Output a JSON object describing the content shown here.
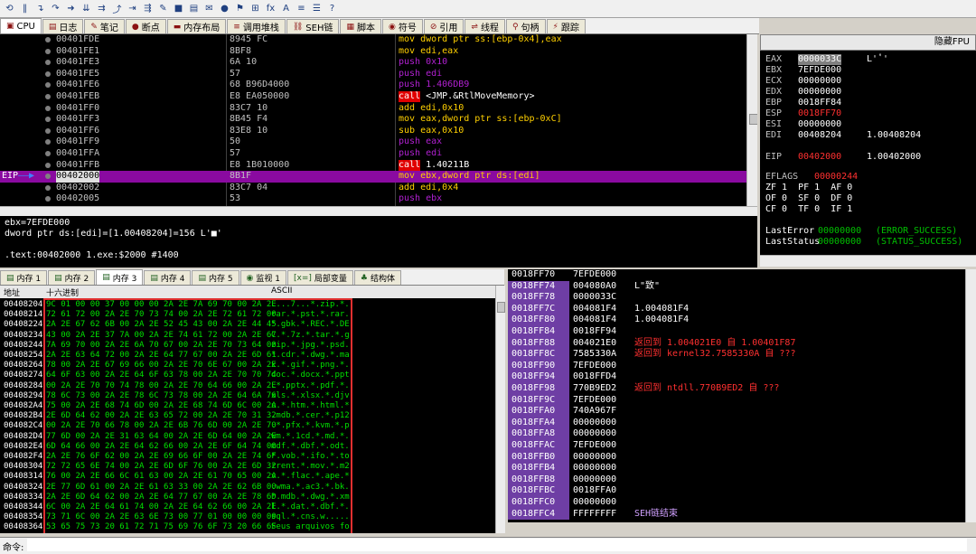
{
  "toolbar": {
    "icons": [
      "restart-icon",
      "pause-icon",
      "step-into-icon",
      "step-over-icon",
      "run-icon",
      "trace-into-icon",
      "trace-over-icon",
      "execute-till-return-icon",
      "run-to-user-icon",
      "animate-icon",
      "patch-icon",
      "lock-icon",
      "memory-map-icon",
      "comment-icon",
      "breakpoint-icon",
      "bookmark-icon",
      "calculator-icon",
      "fx-icon",
      "font-icon",
      "asm-icon",
      "list-icon",
      "help-icon"
    ],
    "glyphs": [
      "⟲",
      "‖",
      "↴",
      "↷",
      "➜",
      "⇊",
      "⇉",
      "⤴",
      "⇥",
      "⇶",
      "✎",
      "■",
      "▤",
      "✉",
      "●",
      "⚑",
      "⊞",
      "fx",
      "A",
      "≡",
      "☰",
      "?"
    ]
  },
  "tabs": [
    {
      "label": "CPU",
      "icon": "cpu-icon",
      "glyph": "▣",
      "active": true
    },
    {
      "label": "日志",
      "icon": "log-icon",
      "glyph": "▤"
    },
    {
      "label": "笔记",
      "icon": "notes-icon",
      "glyph": "✎"
    },
    {
      "label": "断点",
      "icon": "breakpoint-icon",
      "glyph": "●"
    },
    {
      "label": "内存布局",
      "icon": "memory-map-icon",
      "glyph": "▬"
    },
    {
      "label": "调用堆栈",
      "icon": "call-stack-icon",
      "glyph": "≡"
    },
    {
      "label": "SEH链",
      "icon": "seh-icon",
      "glyph": "⛓"
    },
    {
      "label": "脚本",
      "icon": "script-icon",
      "glyph": "▦"
    },
    {
      "label": "符号",
      "icon": "symbol-icon",
      "glyph": "◉"
    },
    {
      "label": "引用",
      "icon": "reference-icon",
      "glyph": "⊘"
    },
    {
      "label": "线程",
      "icon": "thread-icon",
      "glyph": "⇌"
    },
    {
      "label": "句柄",
      "icon": "handle-icon",
      "glyph": "⚲"
    },
    {
      "label": "跟踪",
      "icon": "trace-icon",
      "glyph": "⚡"
    }
  ],
  "fpu_toggle": "隐藏FPU",
  "cpu": {
    "eip_label": "EIP",
    "rows": [
      {
        "addr": "00401FDE",
        "bytes": "8945 FC",
        "asm": "mov dword ptr ss:[ebp-0x4],eax",
        "kind": "normal"
      },
      {
        "addr": "00401FE1",
        "bytes": "8BF8",
        "asm": "mov edi,eax",
        "kind": "normal"
      },
      {
        "addr": "00401FE3",
        "bytes": "6A 10",
        "asm": "push 0x10",
        "kind": "push"
      },
      {
        "addr": "00401FE5",
        "bytes": "57",
        "asm": "push edi",
        "kind": "push"
      },
      {
        "addr": "00401FE6",
        "bytes": "68 B96D4000",
        "asm": "push 1.406DB9",
        "kind": "push"
      },
      {
        "addr": "00401FEB",
        "bytes": "E8 EA050000",
        "asm": "call <JMP.&RtlMoveMemory>",
        "kind": "call"
      },
      {
        "addr": "00401FF0",
        "bytes": "83C7 10",
        "asm": "add edi,0x10",
        "kind": "normal"
      },
      {
        "addr": "00401FF3",
        "bytes": "8B45 F4",
        "asm": "mov eax,dword ptr ss:[ebp-0xC]",
        "kind": "normal"
      },
      {
        "addr": "00401FF6",
        "bytes": "83E8 10",
        "asm": "sub eax,0x10",
        "kind": "normal"
      },
      {
        "addr": "00401FF9",
        "bytes": "50",
        "asm": "push eax",
        "kind": "push"
      },
      {
        "addr": "00401FFA",
        "bytes": "57",
        "asm": "push edi",
        "kind": "push"
      },
      {
        "addr": "00401FFB",
        "bytes": "E8 1B010000",
        "asm": "call 1.40211B",
        "kind": "call"
      },
      {
        "addr": "00402000",
        "bytes": "8B1F",
        "asm": "mov ebx,dword ptr ds:[edi]",
        "kind": "current"
      },
      {
        "addr": "00402002",
        "bytes": "83C7 04",
        "asm": "add edi,0x4",
        "kind": "normal"
      },
      {
        "addr": "00402005",
        "bytes": "53",
        "asm": "push ebx",
        "kind": "push"
      }
    ]
  },
  "info": {
    "line1": "ebx=7EFDE000",
    "line2": "dword ptr ds:[edi]=[1.00408204]=156 L'■'",
    "line3": ".text:00402000 1.exe:$2000 #1400"
  },
  "registers": [
    {
      "name": "EAX",
      "value": "0000033C",
      "comment": "L'ʽ'",
      "highlight": true
    },
    {
      "name": "EBX",
      "value": "7EFDE000",
      "comment": ""
    },
    {
      "name": "ECX",
      "value": "00000000",
      "comment": ""
    },
    {
      "name": "EDX",
      "value": "00000000",
      "comment": ""
    },
    {
      "name": "EBP",
      "value": "0018FF84",
      "comment": ""
    },
    {
      "name": "ESP",
      "value": "0018FF70",
      "comment": "",
      "red": true
    },
    {
      "name": "ESI",
      "value": "00000000",
      "comment": ""
    },
    {
      "name": "EDI",
      "value": "00408204",
      "comment": "1.00408204"
    }
  ],
  "eip": {
    "name": "EIP",
    "value": "00402000",
    "comment": "1.00402000"
  },
  "eflags": {
    "label": "EFLAGS",
    "value": "00000244"
  },
  "flags_line1": "ZF 1  PF 1  AF 0",
  "flags_line2": "OF 0  SF 0  DF 0",
  "flags_line3": "CF 0  TF 0  IF 1",
  "last_error": {
    "label": "LastError",
    "value": "00000000",
    "comment": "(ERROR_SUCCESS)"
  },
  "last_status": {
    "label": "LastStatus",
    "value": "00000000",
    "comment": "(STATUS_SUCCESS)"
  },
  "dump_tabs": [
    {
      "label": "内存 1",
      "icon": "memory-icon",
      "glyph": "▤"
    },
    {
      "label": "内存 2",
      "icon": "memory-icon",
      "glyph": "▤"
    },
    {
      "label": "内存 3",
      "icon": "memory-icon",
      "glyph": "▤",
      "active": true
    },
    {
      "label": "内存 4",
      "icon": "memory-icon",
      "glyph": "▤"
    },
    {
      "label": "内存 5",
      "icon": "memory-icon",
      "glyph": "▤"
    },
    {
      "label": "监视 1",
      "icon": "watch-icon",
      "glyph": "◉"
    },
    {
      "label": "局部变量",
      "icon": "locals-icon",
      "glyph": "[x=]"
    },
    {
      "label": "结构体",
      "icon": "struct-icon",
      "glyph": "♣"
    }
  ],
  "dump_headers": {
    "addr": "地址",
    "hex": "十六进制",
    "ascii": "ASCII"
  },
  "dump_rows": [
    {
      "addr": "00408204",
      "hex": "9C 01 00 00 37 00 00 00 2A 2E 7A 69 70 00 2A 2E",
      "ascii": "....7...*.zip.*."
    },
    {
      "addr": "00408214",
      "hex": "72 61 72 00 2A 2E 70 73 74 00 2A 2E 72 61 72 00",
      "ascii": "rar.*.pst.*.rar."
    },
    {
      "addr": "00408224",
      "hex": "2A 2E 67 62 6B 00 2A 2E 52 45 43 00 2A 2E 44 45",
      "ascii": "*.gbk.*.REC.*.DE"
    },
    {
      "addr": "00408234",
      "hex": "43 00 2A 2E 37 7A 00 2A 2E 74 61 72 00 2A 2E 67",
      "ascii": "C.*.7z.*.tar.*.g"
    },
    {
      "addr": "00408244",
      "hex": "7A 69 70 00 2A 2E 6A 70 67 00 2A 2E 70 73 64 00",
      "ascii": "zip.*.jpg.*.psd."
    },
    {
      "addr": "00408254",
      "hex": "2A 2E 63 64 72 00 2A 2E 64 77 67 00 2A 2E 6D 61",
      "ascii": "*.cdr.*.dwg.*.ma"
    },
    {
      "addr": "00408264",
      "hex": "78 00 2A 2E 67 69 66 00 2A 2E 70 6E 67 00 2A 2E",
      "ascii": "x.*.gif.*.png.*."
    },
    {
      "addr": "00408274",
      "hex": "64 6F 63 00 2A 2E 64 6F 63 78 00 2A 2E 70 70 74",
      "ascii": "doc.*.docx.*.ppt"
    },
    {
      "addr": "00408284",
      "hex": "00 2A 2E 70 70 74 78 00 2A 2E 70 64 66 00 2A 2E",
      "ascii": ".*.pptx.*.pdf.*."
    },
    {
      "addr": "00408294",
      "hex": "78 6C 73 00 2A 2E 78 6C 73 78 00 2A 2E 64 6A 76",
      "ascii": "xls.*.xlsx.*.djv"
    },
    {
      "addr": "004082A4",
      "hex": "75 00 2A 2E 68 74 6D 00 2A 2E 68 74 6D 6C 00 2A",
      "ascii": "u.*.htm.*.html.*"
    },
    {
      "addr": "004082B4",
      "hex": "2E 6D 64 62 00 2A 2E 63 65 72 00 2A 2E 70 31 32",
      "ascii": ".mdb.*.cer.*.p12"
    },
    {
      "addr": "004082C4",
      "hex": "00 2A 2E 70 66 78 00 2A 2E 6B 76 6D 00 2A 2E 70",
      "ascii": ".*.pfx.*.kvm.*.p"
    },
    {
      "addr": "004082D4",
      "hex": "77 6D 00 2A 2E 31 63 64 00 2A 2E 6D 64 00 2A 2E",
      "ascii": "wm.*.1cd.*.md.*."
    },
    {
      "addr": "004082E4",
      "hex": "6D 64 66 00 2A 2E 64 62 66 00 2A 2E 6F 64 74 00",
      "ascii": "mdf.*.dbf.*.odt."
    },
    {
      "addr": "004082F4",
      "hex": "2A 2E 76 6F 62 00 2A 2E 69 66 6F 00 2A 2E 74 6F",
      "ascii": "*.vob.*.ifo.*.to"
    },
    {
      "addr": "00408304",
      "hex": "72 72 65 6E 74 00 2A 2E 6D 6F 76 00 2A 2E 6D 32",
      "ascii": "rrent.*.mov.*.m2"
    },
    {
      "addr": "00408314",
      "hex": "76 00 2A 2E 66 6C 61 63 00 2A 2E 61 70 65 00 2A",
      "ascii": "v.*.flac.*.ape.*"
    },
    {
      "addr": "00408324",
      "hex": "2E 77 6D 61 00 2A 2E 61 63 33 00 2A 2E 62 6B 00",
      "ascii": ".wma.*.ac3.*.bk."
    },
    {
      "addr": "00408334",
      "hex": "2A 2E 6D 64 62 00 2A 2E 64 77 67 00 2A 2E 78 6D",
      "ascii": "*.mdb.*.dwg.*.xm"
    },
    {
      "addr": "00408344",
      "hex": "6C 00 2A 2E 64 61 74 00 2A 2E 64 62 66 00 2A 2E",
      "ascii": "l.*.dat.*.dbf.*."
    },
    {
      "addr": "00408354",
      "hex": "73 71 6C 00 2A 2E 63 6E 73 00 77 01 00 00 00 00",
      "ascii": "sql.*.cns.w....."
    },
    {
      "addr": "00408364",
      "hex": "53 65 75 73 20 61 72 71 75 69 76 6F 73 20 66 6F",
      "ascii": "Seus arquivos fo"
    }
  ],
  "stack_rows": [
    {
      "addr": "0018FF70",
      "value": "7EFDE000",
      "comment": "",
      "current": true
    },
    {
      "addr": "0018FF74",
      "value": "004080A0",
      "comment": "L\"致\""
    },
    {
      "addr": "0018FF78",
      "value": "0000033C",
      "comment": ""
    },
    {
      "addr": "0018FF7C",
      "value": "004081F4",
      "comment": "1.004081F4"
    },
    {
      "addr": "0018FF80",
      "value": "004081F4",
      "comment": "1.004081F4"
    },
    {
      "addr": "0018FF84",
      "value": "0018FF94",
      "comment": ""
    },
    {
      "addr": "0018FF88",
      "value": "004021E0",
      "comment": "返回到 1.004021E0 自 1.00401F87",
      "red": true
    },
    {
      "addr": "0018FF8C",
      "value": "7585330A",
      "comment": "返回到 kernel32.7585330A 自 ???",
      "red": true
    },
    {
      "addr": "0018FF90",
      "value": "7EFDE000",
      "comment": ""
    },
    {
      "addr": "0018FF94",
      "value": "0018FFD4",
      "comment": ""
    },
    {
      "addr": "0018FF98",
      "value": "770B9ED2",
      "comment": "返回到 ntdll.770B9ED2 自 ???",
      "red": true
    },
    {
      "addr": "0018FF9C",
      "value": "7EFDE000",
      "comment": ""
    },
    {
      "addr": "0018FFA0",
      "value": "740A967F",
      "comment": ""
    },
    {
      "addr": "0018FFA4",
      "value": "00000000",
      "comment": ""
    },
    {
      "addr": "0018FFA8",
      "value": "00000000",
      "comment": ""
    },
    {
      "addr": "0018FFAC",
      "value": "7EFDE000",
      "comment": ""
    },
    {
      "addr": "0018FFB0",
      "value": "00000000",
      "comment": ""
    },
    {
      "addr": "0018FFB4",
      "value": "00000000",
      "comment": ""
    },
    {
      "addr": "0018FFB8",
      "value": "00000000",
      "comment": ""
    },
    {
      "addr": "0018FFBC",
      "value": "0018FFA0",
      "comment": ""
    },
    {
      "addr": "0018FFC0",
      "value": "00000000",
      "comment": ""
    },
    {
      "addr": "0018FFC4",
      "value": "FFFFFFFF",
      "comment": "SEH链结束",
      "purple": true
    }
  ],
  "command": {
    "label": "命令:",
    "value": ""
  }
}
